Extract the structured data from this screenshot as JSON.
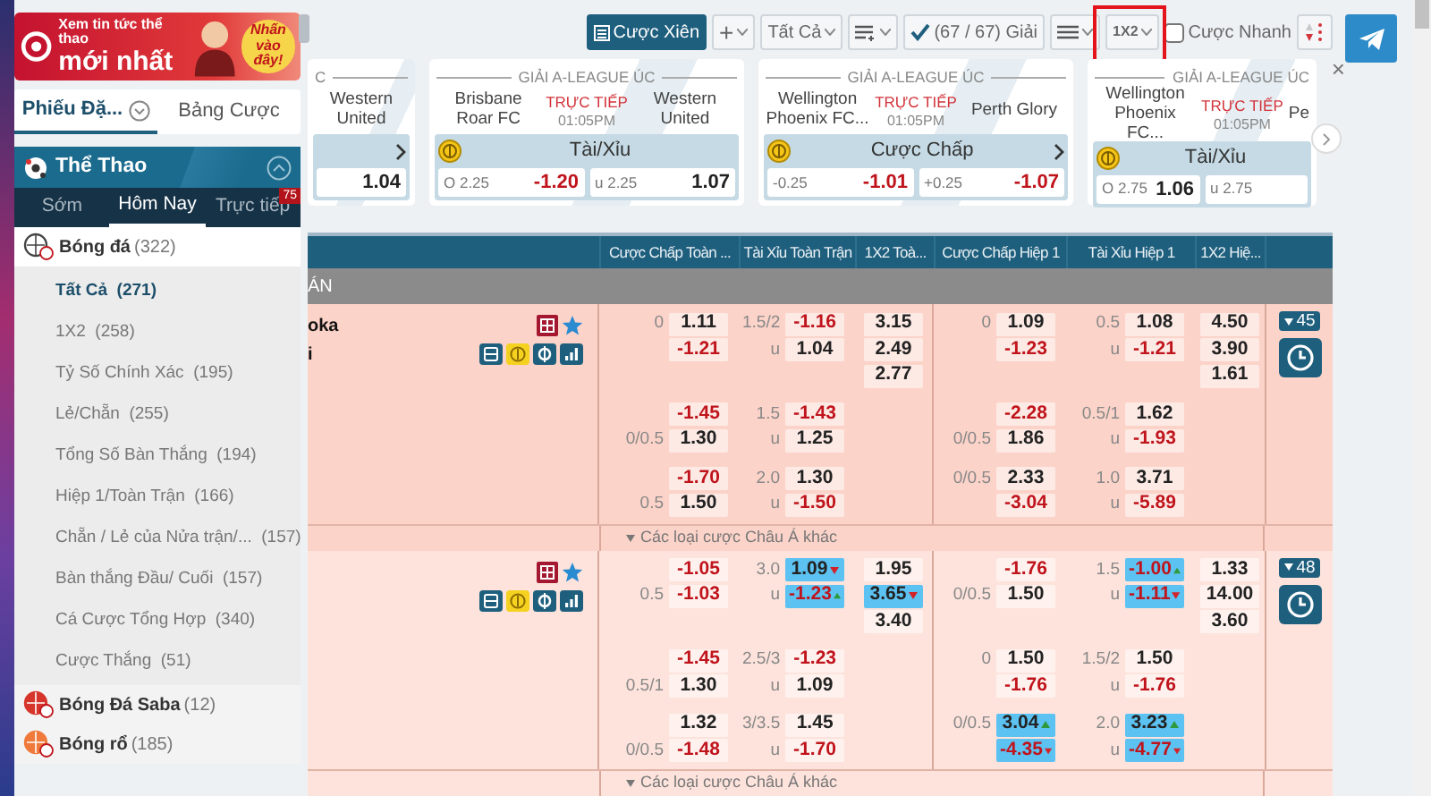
{
  "banner": {
    "headline": "Xem tin tức thể thao",
    "title": "mới nhất",
    "cta": "Nhấn vào đây!"
  },
  "side_tabs": [
    {
      "label": "Phiếu Đặ...",
      "selected": true
    },
    {
      "label": "Bảng Cược",
      "selected": false
    }
  ],
  "sports_panel": {
    "title": "Thể Thao",
    "expanded": true
  },
  "time_tabs": [
    {
      "label": "Sớm",
      "selected": false
    },
    {
      "label": "Hôm Nay",
      "selected": true
    },
    {
      "label": "Trực tiếp",
      "selected": false,
      "badge": "75"
    }
  ],
  "sports": [
    {
      "kind": "football",
      "label": "Bóng đá",
      "count": "(322)",
      "expanded": true,
      "children": [
        {
          "label": "Tất Cả",
          "count": "(271)",
          "selected": true
        },
        {
          "label": "1X2",
          "count": "(258)",
          "selected": false
        },
        {
          "label": "Tỷ Số Chính Xác",
          "count": "(195)",
          "selected": false
        },
        {
          "label": "Lẻ/Chẵn",
          "count": "(255)",
          "selected": false
        },
        {
          "label": "Tổng Số Bàn Thắng",
          "count": "(194)",
          "selected": false
        },
        {
          "label": "Hiệp 1/Toàn Trận",
          "count": "(166)",
          "selected": false
        },
        {
          "label": "Chẵn / Lẻ của Nửa trận/...",
          "count": "(157)",
          "selected": false
        },
        {
          "label": "Bàn thắng Đầu/ Cuối",
          "count": "(157)",
          "selected": false
        },
        {
          "label": "Cá Cược Tổng Hợp",
          "count": "(340)",
          "selected": false
        },
        {
          "label": "Cược Thắng",
          "count": "(51)",
          "selected": false
        }
      ]
    },
    {
      "kind": "saba",
      "label": "Bóng Đá Saba",
      "count": "(12)",
      "expanded": false
    },
    {
      "kind": "basketball",
      "label": "Bóng rổ",
      "count": "(185)",
      "expanded": false
    }
  ],
  "toolbar": {
    "parlay": "Cược Xiên",
    "add": "+",
    "filter": "Tất Cả",
    "leagues": "(67 / 67) Giải",
    "odds_type": "1X2",
    "quick_bet": {
      "label": "Cược Nhanh",
      "checked": false
    }
  },
  "carousel": {
    "close": "×",
    "cards": [
      {
        "kind": "partial_left",
        "league": "C",
        "away": "Western United",
        "has_arrow": true,
        "odds": [
          {
            "value": "1.04"
          }
        ]
      },
      {
        "kind": "full",
        "league": "GIẢI A-LEAGUE ÚC",
        "home": "Brisbane Roar FC",
        "status": "TRỰC TIẾP",
        "time": "01:05PM",
        "away": "Western United",
        "market": "Tài/Xỉu",
        "has_arrow": false,
        "odds": [
          {
            "line": "O 2.25",
            "value": "-1.20"
          },
          {
            "line": "u 2.25",
            "value": "1.07"
          }
        ]
      },
      {
        "kind": "full",
        "league": "GIẢI A-LEAGUE ÚC",
        "home": "Wellington Phoenix FC...",
        "status": "TRỰC TIẾP",
        "time": "01:05PM",
        "away": "Perth Glory",
        "market": "Cược Chấp",
        "has_arrow": true,
        "odds": [
          {
            "line": "-0.25",
            "value": "-1.01"
          },
          {
            "line": "+0.25",
            "value": "-1.07"
          }
        ]
      },
      {
        "kind": "partial_right",
        "league": "GIẢI A-LEAGUE ÚC",
        "home": "Wellington Phoenix FC...",
        "status": "TRỰC TIẾP",
        "time": "01:05PM",
        "away": "Pe",
        "market": "Tài/Xỉu",
        "has_arrow": false,
        "odds": [
          {
            "line": "O 2.75",
            "value": "1.06"
          },
          {
            "line": "u 2.75"
          }
        ]
      }
    ]
  },
  "table": {
    "columns": [
      "Cược Chấp Toàn ...",
      "Tài Xỉu Toàn Trận",
      "1X2 Toà...",
      "Cược Chấp Hiệp 1",
      "Tài Xỉu Hiệp 1",
      "1X2 Hiệ..."
    ],
    "league": "ÁN",
    "matches": [
      {
        "teams": [
          "oka",
          "i"
        ],
        "badge": "45",
        "more": "Các loại cược Châu Á khác",
        "blocks": [
          {
            "ah": [
              {
                "line": "0",
                "odds": "1.11"
              },
              {
                "odds": "-1.21"
              }
            ],
            "ou": [
              {
                "line": "1.5/2",
                "odds": "-1.16"
              },
              {
                "line": "u",
                "odds": "1.04"
              }
            ],
            "x12": [
              {
                "odds": "3.15"
              },
              {
                "odds": "2.49"
              },
              {
                "odds": "2.77"
              }
            ],
            "ah_h1": [
              {
                "line": "0",
                "odds": "1.09"
              },
              {
                "odds": "-1.23"
              }
            ],
            "ou_h1": [
              {
                "line": "0.5",
                "odds": "1.08"
              },
              {
                "line": "u",
                "odds": "-1.21"
              }
            ],
            "x12_h1": [
              {
                "odds": "4.50"
              },
              {
                "odds": "3.90"
              },
              {
                "odds": "1.61"
              }
            ]
          },
          {
            "ah": [
              {
                "odds": "-1.45"
              },
              {
                "line": "0/0.5",
                "odds": "1.30"
              }
            ],
            "ou": [
              {
                "line": "1.5",
                "odds": "-1.43"
              },
              {
                "line": "u",
                "odds": "1.25"
              }
            ],
            "ah_h1": [
              {
                "odds": "-2.28"
              },
              {
                "line": "0/0.5",
                "odds": "1.86"
              }
            ],
            "ou_h1": [
              {
                "line": "0.5/1",
                "odds": "1.62"
              },
              {
                "line": "u",
                "odds": "-1.93"
              }
            ]
          },
          {
            "ah": [
              {
                "odds": "-1.70"
              },
              {
                "line": "0.5",
                "odds": "1.50"
              }
            ],
            "ou": [
              {
                "line": "2.0",
                "odds": "1.30"
              },
              {
                "line": "u",
                "odds": "-1.50"
              }
            ],
            "ah_h1": [
              {
                "line": "0/0.5",
                "odds": "2.33"
              },
              {
                "odds": "-3.04"
              }
            ],
            "ou_h1": [
              {
                "line": "1.0",
                "odds": "3.71"
              },
              {
                "line": "u",
                "odds": "-5.89"
              }
            ]
          }
        ]
      },
      {
        "badge": "48",
        "more": "Các loại cược Châu Á khác",
        "blocks": [
          {
            "ah": [
              {
                "odds": "-1.05"
              },
              {
                "line": "0.5",
                "odds": "-1.03"
              }
            ],
            "ou": [
              {
                "line": "3.0",
                "odds": "1.09",
                "rising": false
              },
              {
                "line": "u",
                "odds": "-1.23",
                "rising": true
              }
            ],
            "x12": [
              {
                "odds": "1.95"
              },
              {
                "odds": "3.65",
                "rising": false
              },
              {
                "odds": "3.40"
              }
            ],
            "ah_h1": [
              {
                "odds": "-1.76"
              },
              {
                "line": "0/0.5",
                "odds": "1.50"
              }
            ],
            "ou_h1": [
              {
                "line": "1.5",
                "odds": "-1.00",
                "rising": true
              },
              {
                "line": "u",
                "odds": "-1.11",
                "rising": false
              }
            ],
            "x12_h1": [
              {
                "odds": "1.33"
              },
              {
                "odds": "14.00"
              },
              {
                "odds": "3.60"
              }
            ]
          },
          {
            "ah": [
              {
                "odds": "-1.45"
              },
              {
                "line": "0.5/1",
                "odds": "1.30"
              }
            ],
            "ou": [
              {
                "line": "2.5/3",
                "odds": "-1.23"
              },
              {
                "line": "u",
                "odds": "1.09"
              }
            ],
            "ah_h1": [
              {
                "line": "0",
                "odds": "1.50"
              },
              {
                "odds": "-1.76"
              }
            ],
            "ou_h1": [
              {
                "line": "1.5/2",
                "odds": "1.50"
              },
              {
                "line": "u",
                "odds": "-1.76"
              }
            ]
          },
          {
            "ah": [
              {
                "odds": "1.32"
              },
              {
                "line": "0/0.5",
                "odds": "-1.48"
              }
            ],
            "ou": [
              {
                "line": "3/3.5",
                "odds": "1.45"
              },
              {
                "line": "u",
                "odds": "-1.70"
              }
            ],
            "ah_h1": [
              {
                "line": "0/0.5",
                "odds": "3.04",
                "rising": true
              },
              {
                "odds": "-4.35",
                "rising": false
              }
            ],
            "ou_h1": [
              {
                "line": "2.0",
                "odds": "3.23",
                "rising": true
              },
              {
                "line": "u",
                "odds": "-4.77",
                "rising": false
              }
            ]
          }
        ]
      }
    ]
  }
}
